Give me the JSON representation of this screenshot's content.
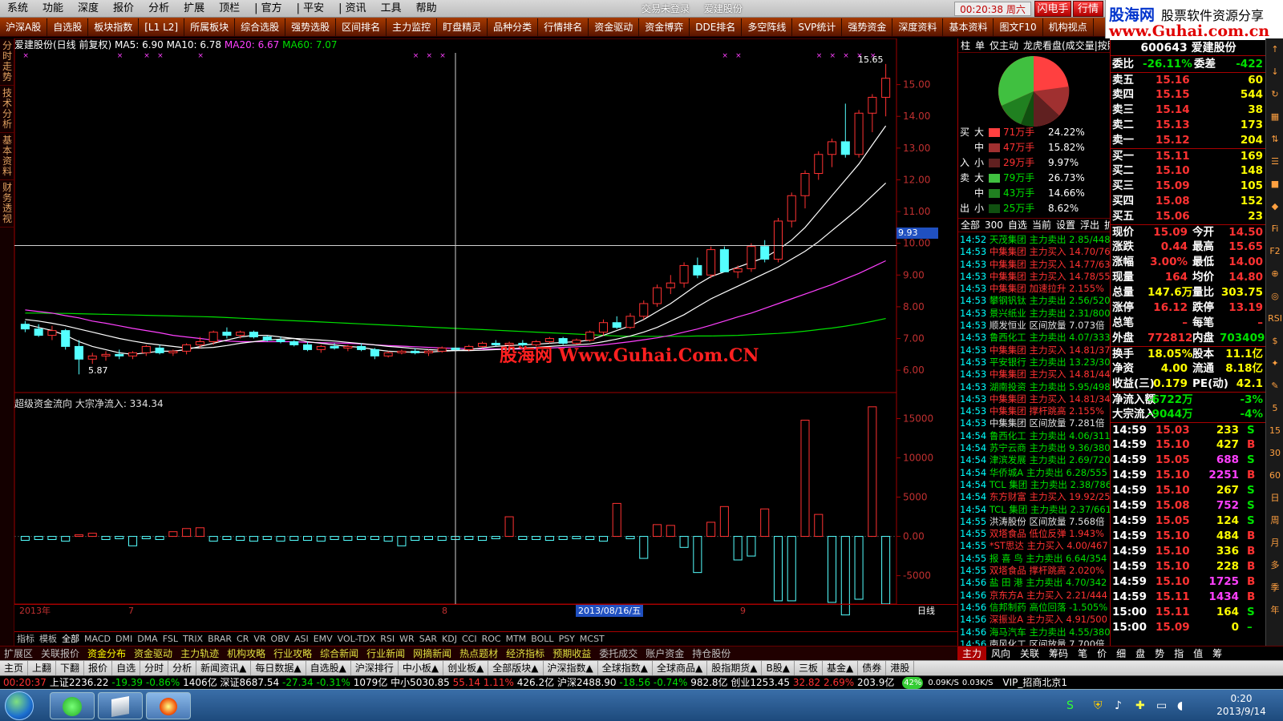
{
  "menu": {
    "items": [
      "系统",
      "功能",
      "深度",
      "报价",
      "分析",
      "扩展",
      "顶栏",
      "| 官方",
      "| 平安",
      "| 资讯",
      "工具",
      "帮助"
    ],
    "login": "交易未登录",
    "stock": "爱建股份",
    "clock": "00:20:38 周六",
    "flash": "闪电手",
    "market": "行情"
  },
  "logo": {
    "site": "股海网",
    "text": "股票软件资源分享",
    "url": "www.Guhai.com.cn"
  },
  "toolbar": [
    "沪深A股",
    "自选股",
    "板块指数",
    "[L1 L2]",
    "所属板块",
    "综合选股",
    "强势选股",
    "区间排名",
    "主力监控",
    "盯盘精灵",
    "品种分类",
    "行情排名",
    "资金驱动",
    "资金博弈",
    "DDE排名",
    "多空阵线",
    "SVP统计",
    "强势资金",
    "深度资料",
    "基本资料",
    "图文F10",
    "机构视点"
  ],
  "lefttabs": [
    "分时走势",
    "技术分析",
    "基本资料",
    "财务透视"
  ],
  "kline": {
    "title": "爱建股份(日线 前复权)",
    "ma5": "MA5: 6.90",
    "ma10": "MA10: 6.78",
    "ma20": "MA20: 6.67",
    "ma60": "MA60: 7.07",
    "high_label": "15.65",
    "low_label": "5.87",
    "cross_price": "9.93",
    "watermark": "股海网 Www.Guhai.Com.CN"
  },
  "flow": {
    "title": "超级资金流向 大宗净流入: 334.34"
  },
  "dates": {
    "year": "2013年",
    "m7": "7",
    "m8": "8",
    "m9": "9",
    "cursor": "2013/08/16/五",
    "period": "日线"
  },
  "colors": {
    "up": "#ff3232",
    "down": "#54ffff",
    "ma5": "#ffffff",
    "ma10": "#ffffff",
    "ma20": "#ff40ff",
    "ma60": "#00e000",
    "grid": "#a00000"
  },
  "chart_data": {
    "type": "candlestick",
    "x_labels": [
      "2013年",
      "7",
      "8",
      "9"
    ],
    "price_ticks": [
      6.0,
      7.0,
      8.0,
      9.0,
      10.0,
      11.0,
      12.0,
      13.0,
      14.0,
      15.0
    ],
    "flow_ticks": [
      -5000,
      0,
      5000,
      10000,
      15000
    ],
    "ylim": [
      5.6,
      16.0
    ],
    "flow_ylim": [
      -8000,
      17500
    ],
    "candles": [
      [
        7.45,
        7.55,
        7.2,
        7.3
      ],
      [
        7.3,
        7.45,
        7.05,
        7.1
      ],
      [
        7.1,
        7.4,
        6.95,
        7.25
      ],
      [
        7.25,
        7.3,
        6.65,
        6.75
      ],
      [
        6.75,
        6.95,
        5.87,
        6.35
      ],
      [
        6.35,
        6.55,
        6.2,
        6.45
      ],
      [
        6.45,
        6.6,
        6.3,
        6.5
      ],
      [
        6.5,
        6.65,
        6.35,
        6.45
      ],
      [
        6.45,
        6.6,
        6.35,
        6.55
      ],
      [
        6.55,
        6.8,
        6.45,
        6.75
      ],
      [
        6.7,
        6.8,
        6.5,
        6.55
      ],
      [
        6.55,
        6.65,
        6.45,
        6.6
      ],
      [
        6.6,
        6.85,
        6.5,
        6.8
      ],
      [
        6.8,
        7.05,
        6.7,
        6.9
      ],
      [
        6.9,
        7.25,
        6.8,
        7.2
      ],
      [
        7.2,
        7.35,
        7.0,
        7.1
      ],
      [
        7.1,
        7.25,
        7.0,
        7.2
      ],
      [
        7.2,
        7.25,
        7.0,
        7.05
      ],
      [
        7.05,
        7.1,
        6.9,
        6.95
      ],
      [
        6.95,
        7.05,
        6.85,
        6.9
      ],
      [
        6.9,
        6.95,
        6.75,
        6.8
      ],
      [
        6.8,
        6.9,
        6.6,
        6.65
      ],
      [
        6.65,
        6.8,
        6.55,
        6.75
      ],
      [
        6.75,
        6.85,
        6.65,
        6.7
      ],
      [
        6.7,
        6.8,
        6.6,
        6.75
      ],
      [
        6.75,
        6.85,
        6.6,
        6.65
      ],
      [
        6.65,
        6.7,
        6.35,
        6.45
      ],
      [
        6.45,
        6.6,
        6.4,
        6.55
      ],
      [
        6.55,
        6.65,
        6.5,
        6.6
      ],
      [
        6.6,
        6.7,
        6.5,
        6.55
      ],
      [
        6.55,
        6.65,
        6.45,
        6.6
      ],
      [
        6.6,
        6.75,
        6.55,
        6.7
      ],
      [
        6.7,
        6.8,
        6.6,
        6.65
      ],
      [
        6.65,
        6.8,
        6.6,
        6.75
      ],
      [
        6.75,
        6.9,
        6.7,
        6.85
      ],
      [
        6.85,
        6.95,
        6.75,
        6.8
      ],
      [
        6.8,
        6.9,
        6.7,
        6.85
      ],
      [
        6.85,
        6.95,
        6.75,
        6.8
      ],
      [
        6.8,
        6.95,
        6.75,
        6.9
      ],
      [
        6.9,
        7.05,
        6.85,
        7.0
      ],
      [
        7.0,
        7.05,
        6.8,
        6.85
      ],
      [
        6.85,
        7.0,
        6.8,
        6.95
      ],
      [
        6.95,
        7.25,
        6.9,
        7.2
      ],
      [
        7.2,
        7.6,
        7.1,
        7.5
      ],
      [
        7.5,
        7.7,
        7.3,
        7.35
      ],
      [
        7.35,
        7.8,
        7.3,
        7.7
      ],
      [
        7.7,
        8.2,
        7.6,
        8.1
      ],
      [
        8.1,
        8.7,
        8.0,
        8.6
      ],
      [
        8.6,
        9.0,
        8.4,
        8.75
      ],
      [
        8.75,
        9.4,
        8.6,
        9.3
      ],
      [
        9.3,
        9.55,
        8.9,
        9.0
      ],
      [
        9.0,
        9.9,
        8.9,
        9.8
      ],
      [
        9.8,
        9.9,
        9.1,
        9.1
      ],
      [
        9.1,
        9.3,
        8.9,
        9.2
      ],
      [
        9.2,
        10.0,
        9.1,
        9.9
      ],
      [
        9.9,
        10.1,
        9.4,
        9.5
      ],
      [
        9.5,
        10.8,
        9.4,
        10.7
      ],
      [
        10.7,
        11.6,
        10.5,
        11.5
      ],
      [
        11.5,
        12.3,
        11.1,
        12.2
      ],
      [
        12.2,
        12.9,
        12.0,
        12.8
      ],
      [
        12.8,
        13.3,
        12.4,
        13.2
      ],
      [
        13.2,
        14.4,
        12.7,
        12.8
      ],
      [
        12.8,
        14.2,
        12.7,
        14.1
      ],
      [
        14.1,
        14.7,
        13.5,
        14.6
      ],
      [
        14.6,
        15.65,
        14.0,
        15.2
      ]
    ],
    "ma5": [
      7.45,
      7.35,
      7.25,
      7.1,
      6.9,
      6.75,
      6.65,
      6.55,
      6.5,
      6.55,
      6.6,
      6.6,
      6.65,
      6.75,
      6.85,
      6.95,
      7.05,
      7.1,
      7.1,
      7.05,
      7.0,
      6.9,
      6.85,
      6.8,
      6.75,
      6.72,
      6.65,
      6.6,
      6.58,
      6.57,
      6.57,
      6.6,
      6.62,
      6.65,
      6.7,
      6.75,
      6.78,
      6.8,
      6.82,
      6.85,
      6.88,
      6.9,
      6.95,
      7.1,
      7.25,
      7.4,
      7.6,
      7.85,
      8.1,
      8.4,
      8.7,
      8.95,
      9.1,
      9.25,
      9.4,
      9.55,
      9.8,
      10.1,
      10.5,
      11.0,
      11.5,
      12.0,
      12.5,
      13.1,
      13.7
    ],
    "ma10": [
      7.6,
      7.55,
      7.48,
      7.4,
      7.3,
      7.2,
      7.1,
      7.0,
      6.92,
      6.85,
      6.8,
      6.75,
      6.7,
      6.7,
      6.72,
      6.78,
      6.85,
      6.9,
      6.95,
      6.98,
      7.0,
      6.98,
      6.95,
      6.92,
      6.88,
      6.84,
      6.8,
      6.75,
      6.72,
      6.68,
      6.65,
      6.63,
      6.62,
      6.62,
      6.63,
      6.65,
      6.67,
      6.7,
      6.72,
      6.75,
      6.78,
      6.8,
      6.83,
      6.9,
      6.98,
      7.08,
      7.2,
      7.35,
      7.55,
      7.75,
      8.0,
      8.25,
      8.45,
      8.65,
      8.85,
      9.05,
      9.25,
      9.5,
      9.75,
      10.05,
      10.4,
      10.75,
      11.1,
      11.5,
      11.9
    ],
    "ma20": [
      7.9,
      7.85,
      7.8,
      7.72,
      7.65,
      7.55,
      7.48,
      7.4,
      7.32,
      7.25,
      7.18,
      7.1,
      7.05,
      7.0,
      6.95,
      6.92,
      6.9,
      6.9,
      6.9,
      6.9,
      6.9,
      6.88,
      6.87,
      6.86,
      6.85,
      6.83,
      6.8,
      6.78,
      6.76,
      6.74,
      6.72,
      6.7,
      6.69,
      6.68,
      6.67,
      6.67,
      6.67,
      6.67,
      6.68,
      6.7,
      6.72,
      6.74,
      6.76,
      6.8,
      6.85,
      6.9,
      6.96,
      7.02,
      7.1,
      7.2,
      7.3,
      7.42,
      7.55,
      7.68,
      7.8,
      7.95,
      8.1,
      8.25,
      8.4,
      8.55,
      8.7,
      8.88,
      9.05,
      9.25,
      9.45
    ],
    "ma60": [
      7.8,
      7.8,
      7.79,
      7.79,
      7.78,
      7.77,
      7.76,
      7.75,
      7.74,
      7.73,
      7.72,
      7.71,
      7.7,
      7.69,
      7.68,
      7.66,
      7.64,
      7.62,
      7.6,
      7.58,
      7.56,
      7.54,
      7.52,
      7.5,
      7.48,
      7.46,
      7.44,
      7.42,
      7.4,
      7.38,
      7.36,
      7.34,
      7.32,
      7.3,
      7.28,
      7.26,
      7.24,
      7.22,
      7.2,
      7.18,
      7.16,
      7.14,
      7.12,
      7.1,
      7.08,
      7.07,
      7.07,
      7.07,
      7.07,
      7.07,
      7.08,
      7.08,
      7.09,
      7.1,
      7.12,
      7.14,
      7.16,
      7.19,
      7.23,
      7.28,
      7.33,
      7.39,
      7.46,
      7.54,
      7.63
    ],
    "flow": [
      -500,
      -400,
      -400,
      -600,
      200,
      400,
      -400,
      -300,
      -1200,
      -300,
      -400,
      600,
      1000,
      1100,
      -600,
      -400,
      -500,
      -600,
      -400,
      -600,
      -500,
      -500,
      -600,
      -400,
      -500,
      -400,
      -400,
      -600,
      -1200,
      -500,
      -400,
      -500,
      -400,
      -400,
      -500,
      -300,
      2500,
      -400,
      -400,
      -500,
      -400,
      -300,
      -400,
      -600,
      4200,
      -300,
      -2800,
      1500,
      1400,
      -1400,
      -4600,
      1800,
      3800,
      -3000,
      -2500,
      3500,
      -8200,
      -8200,
      14800,
      2800,
      -8400,
      -10000,
      -8000,
      16500,
      -8600
    ]
  },
  "rpanel": {
    "tabs": [
      "柱",
      "单",
      "仅主动",
      "龙虎看盘(成交量|按照"
    ],
    "orders": [
      {
        "side": "买",
        "size": "大",
        "color": "#ff4040",
        "amount": "71万手",
        "pct": "24.22%"
      },
      {
        "side": "",
        "size": "中",
        "color": "#a03030",
        "amount": "47万手",
        "pct": "15.82%"
      },
      {
        "side": "入",
        "size": "小",
        "color": "#602020",
        "amount": "29万手",
        "pct": "9.97%"
      },
      {
        "side": "卖",
        "size": "大",
        "color": "#40c040",
        "amount": "79万手",
        "pct": "26.73%"
      },
      {
        "side": "",
        "size": "中",
        "color": "#208020",
        "amount": "43万手",
        "pct": "14.66%"
      },
      {
        "side": "出",
        "size": "小",
        "color": "#105010",
        "amount": "25万手",
        "pct": "8.62%"
      }
    ],
    "subtabs": [
      "全部",
      "300",
      "自选",
      "当前",
      "设置",
      "浮出",
      "扩大"
    ],
    "news": [
      [
        "14:52",
        "天茂集团",
        "主力卖出",
        "2.85/448"
      ],
      [
        "14:53",
        "中集集团",
        "主力买入",
        "14.70/76"
      ],
      [
        "14:53",
        "中集集团",
        "主力买入",
        "14.77/63"
      ],
      [
        "14:53",
        "中集集团",
        "主力买入",
        "14.78/55"
      ],
      [
        "14:53",
        "中集集团",
        "加速拉升",
        "2.155%"
      ],
      [
        "14:53",
        "攀钢钒钛",
        "主力卖出",
        "2.56/520"
      ],
      [
        "14:53",
        "景兴纸业",
        "主力卖出",
        "2.31/800"
      ],
      [
        "14:53",
        "顺发恒业",
        "区间放量",
        "7.073倍"
      ],
      [
        "14:53",
        "鲁西化工",
        "主力卖出",
        "4.07/333"
      ],
      [
        "14:53",
        "中集集团",
        "主力买入",
        "14.81/37"
      ],
      [
        "14:53",
        "平安银行",
        "主力卖出",
        "13.23/30"
      ],
      [
        "14:53",
        "中集集团",
        "主力买入",
        "14.81/44"
      ],
      [
        "14:53",
        "湖南投资",
        "主力卖出",
        "5.95/498"
      ],
      [
        "14:53",
        "中集集团",
        "主力买入",
        "14.81/34"
      ],
      [
        "14:53",
        "中集集团",
        "撑杆跳高",
        "2.155%"
      ],
      [
        "14:53",
        "中集集团",
        "区间放量",
        "7.281倍"
      ],
      [
        "14:54",
        "鲁西化工",
        "主力卖出",
        "4.06/311"
      ],
      [
        "14:54",
        "苏宁云商",
        "主力卖出",
        "9.36/380"
      ],
      [
        "14:54",
        "津滨发展",
        "主力卖出",
        "2.69/720"
      ],
      [
        "14:54",
        "华侨城A",
        "主力卖出",
        "6.28/555"
      ],
      [
        "14:54",
        "TCL 集团",
        "主力卖出",
        "2.38/786"
      ],
      [
        "14:54",
        "东方财富",
        "主力买入",
        "19.92/25"
      ],
      [
        "14:54",
        "TCL 集团",
        "主力卖出",
        "2.37/661"
      ],
      [
        "14:55",
        "洪涛股份",
        "区间放量",
        "7.568倍"
      ],
      [
        "14:55",
        "双塔食品",
        "低位反弹",
        "1.943%"
      ],
      [
        "14:55",
        "*ST思达",
        "主力买入",
        "4.00/467"
      ],
      [
        "14:55",
        "报 喜 鸟",
        "主力卖出",
        "6.64/354"
      ],
      [
        "14:55",
        "双塔食品",
        "撑杆跳高",
        "2.020%"
      ],
      [
        "14:56",
        "盐 田 港",
        "主力卖出",
        "4.70/342"
      ],
      [
        "14:56",
        "京东方A",
        "主力买入",
        "2.21/444"
      ],
      [
        "14:56",
        "信邦制药",
        "高位回落",
        "-1.505%"
      ],
      [
        "14:56",
        "深振业A",
        "主力买入",
        "4.91/500"
      ],
      [
        "14:56",
        "海马汽车",
        "主力卖出",
        "4.55/380"
      ],
      [
        "14:56",
        "南风化工",
        "区间放量",
        "7.700倍"
      ]
    ]
  },
  "quote": {
    "title": "600643 爱建股份",
    "weibi": {
      "label": "委比",
      "value": "-26.11%",
      "label2": "委差",
      "value2": "-422"
    },
    "asks": [
      [
        "卖五",
        "15.16",
        "60"
      ],
      [
        "卖四",
        "15.15",
        "544"
      ],
      [
        "卖三",
        "15.14",
        "38"
      ],
      [
        "卖二",
        "15.13",
        "173"
      ],
      [
        "卖一",
        "15.12",
        "204"
      ]
    ],
    "bids": [
      [
        "买一",
        "15.11",
        "169"
      ],
      [
        "买二",
        "15.10",
        "148"
      ],
      [
        "买三",
        "15.09",
        "105"
      ],
      [
        "买四",
        "15.08",
        "152"
      ],
      [
        "买五",
        "15.06",
        "23"
      ]
    ],
    "stats": [
      [
        "现价",
        "15.09",
        "今开",
        "14.50"
      ],
      [
        "涨跌",
        "0.44",
        "最高",
        "15.65"
      ],
      [
        "涨幅",
        "3.00%",
        "最低",
        "14.00"
      ],
      [
        "现量",
        "164",
        "均价",
        "14.80"
      ],
      [
        "总量",
        "147.6万",
        "量比",
        "303.75"
      ],
      [
        "涨停",
        "16.12",
        "跌停",
        "13.19"
      ],
      [
        "总笔",
        "–",
        "每笔",
        "–"
      ],
      [
        "外盘",
        "772812",
        "内盘",
        "703409"
      ],
      [
        "换手",
        "18.05%",
        "股本",
        "11.1亿"
      ],
      [
        "净资",
        "4.00",
        "流通",
        "8.18亿"
      ],
      [
        "收益(三)",
        "0.179",
        "PE(动)",
        "42.1"
      ],
      [
        "净流入额",
        "-6722万",
        "",
        "-3%"
      ],
      [
        "大宗流入",
        "-9044万",
        "",
        "-4%"
      ]
    ],
    "ticks": [
      [
        "14:59",
        "15.03",
        "233",
        "S"
      ],
      [
        "14:59",
        "15.10",
        "427",
        "B"
      ],
      [
        "14:59",
        "15.05",
        "688",
        "S"
      ],
      [
        "14:59",
        "15.10",
        "2251",
        "B"
      ],
      [
        "14:59",
        "15.10",
        "267",
        "S"
      ],
      [
        "14:59",
        "15.08",
        "752",
        "S"
      ],
      [
        "14:59",
        "15.05",
        "124",
        "S"
      ],
      [
        "14:59",
        "15.10",
        "484",
        "B"
      ],
      [
        "14:59",
        "15.10",
        "336",
        "B"
      ],
      [
        "14:59",
        "15.10",
        "228",
        "B"
      ],
      [
        "14:59",
        "15.10",
        "1725",
        "B"
      ],
      [
        "14:59",
        "15.11",
        "1434",
        "B"
      ],
      [
        "15:00",
        "15.11",
        "164",
        "S"
      ],
      [
        "15:00",
        "15.09",
        "0",
        "–"
      ]
    ]
  },
  "icons": [
    "↑",
    "↓",
    "↻",
    "▦",
    "⇅",
    "☰",
    "■",
    "◆",
    "Fi",
    "F2",
    "⊕",
    "◎",
    "RSI",
    "$",
    "✦",
    "✎",
    "5",
    "15",
    "30",
    "60",
    "日",
    "周",
    "月",
    "多",
    "季",
    "年"
  ],
  "indicators": [
    "指标",
    "模板",
    "全部",
    "MACD",
    "DMI",
    "DMA",
    "FSL",
    "TRIX",
    "BRAR",
    "CR",
    "VR",
    "OBV",
    "ASI",
    "EMV",
    "VOL-TDX",
    "RSI",
    "WR",
    "SAR",
    "KDJ",
    "CCI",
    "ROC",
    "MTM",
    "BOLL",
    "PSY",
    "MCST"
  ],
  "funcs": [
    "扩展区",
    "关联报价",
    "资金分布",
    "资金驱动",
    "主力轨迹",
    "机构攻略",
    "行业攻略",
    "综合新闻",
    "行业新闻",
    "网摘新闻",
    "热点题材",
    "经济指标",
    "预期收益",
    "委托成交",
    "账户资金",
    "持仓股份"
  ],
  "nav": [
    "主页",
    "上翻",
    "下翻",
    "报价",
    "自选",
    "分时",
    "分析",
    "新闻资讯▲",
    "每日数据▲",
    "自选股▲",
    "沪深排行",
    "中小板▲",
    "创业板▲",
    "全部版块▲",
    "沪深指数▲",
    "全球指数▲",
    "全球商品▲",
    "股指期货▲",
    "B股▲",
    "三板",
    "基金▲",
    "债券",
    "港股"
  ],
  "rbot": [
    "主力",
    "风向",
    "关联",
    "筹码",
    "笔",
    "价",
    "细",
    "盘",
    "势",
    "指",
    "值",
    "筹"
  ],
  "status": {
    "time": "00:20:37",
    "sh": "上证2236.22",
    "sh_chg": "-19.39",
    "sh_pct": "-0.86%",
    "sh_vol": "1406亿",
    "sz": "深证8687.54",
    "sz_chg": "-27.34",
    "sz_pct": "-0.31%",
    "sz_vol": "1079亿",
    "zx": "中小5030.85",
    "zx_chg": "55.14",
    "zx_pct": "1.11%",
    "zx_vol": "426.2亿",
    "hs": "沪深2488.90",
    "hs_chg": "-18.56",
    "hs_pct": "-0.74%",
    "hs_vol": "982.8亿",
    "cy": "创业1253.45",
    "cy_chg": "32.82",
    "cy_pct": "2.69%",
    "cy_vol": "203.9亿",
    "net": "42%",
    "up": "0.09K/S",
    "down": "0.03K/S",
    "vip": "VIP_招商北京1"
  },
  "taskbar": {
    "time": "0:20",
    "date": "2013/9/14"
  }
}
